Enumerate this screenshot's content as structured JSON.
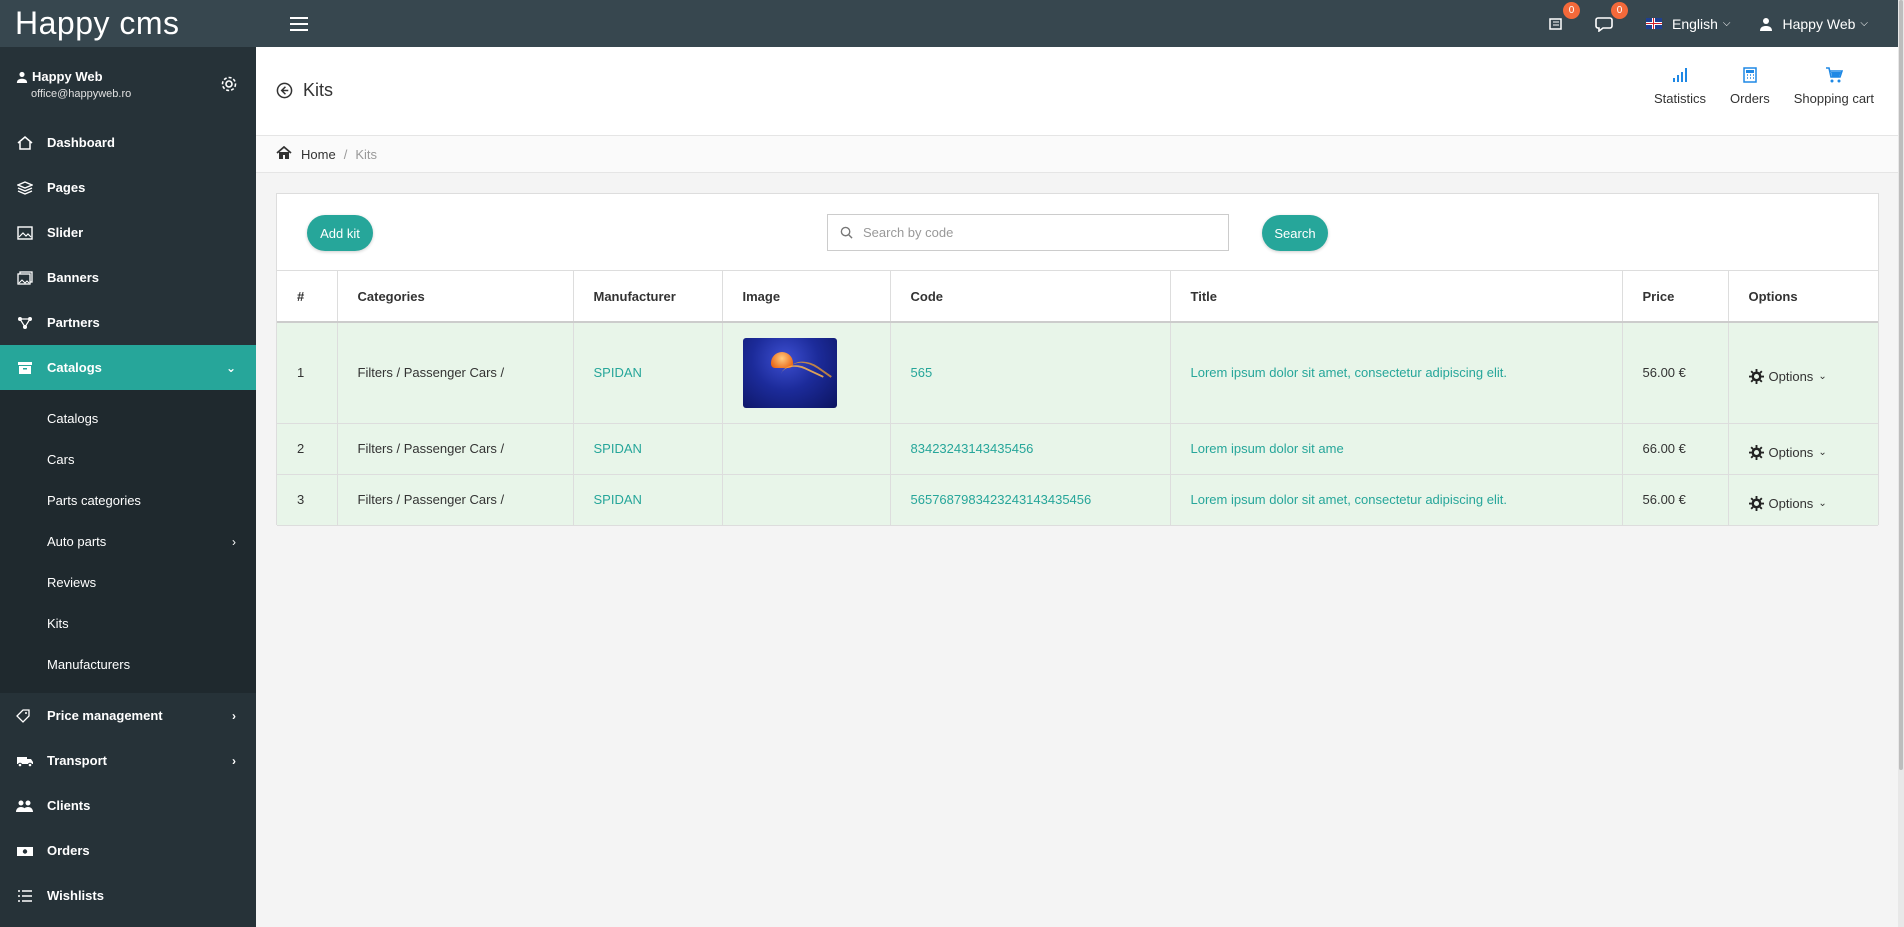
{
  "app": {
    "brand": "Happy cms"
  },
  "topbar": {
    "notifications_count": "0",
    "messages_count": "0",
    "language": "English",
    "user": "Happy Web"
  },
  "sidebar": {
    "profile": {
      "name": "Happy Web",
      "email": "office@happyweb.ro"
    },
    "items": [
      {
        "label": "Dashboard",
        "icon": "home-icon"
      },
      {
        "label": "Pages",
        "icon": "layers-icon"
      },
      {
        "label": "Slider",
        "icon": "image-icon"
      },
      {
        "label": "Banners",
        "icon": "images-icon"
      },
      {
        "label": "Partners",
        "icon": "network-icon"
      },
      {
        "label": "Catalogs",
        "icon": "archive-icon"
      }
    ],
    "submenu": [
      "Catalogs",
      "Cars",
      "Parts categories",
      "Auto parts",
      "Reviews",
      "Kits",
      "Manufacturers"
    ],
    "items_after": [
      {
        "label": "Price management",
        "icon": "price-tag-icon"
      },
      {
        "label": "Transport",
        "icon": "truck-icon"
      },
      {
        "label": "Clients",
        "icon": "users-icon"
      },
      {
        "label": "Orders",
        "icon": "cash-icon"
      },
      {
        "label": "Wishlists",
        "icon": "list-icon"
      }
    ]
  },
  "header": {
    "title": "Kits",
    "actions": [
      "Statistics",
      "Orders",
      "Shopping cart"
    ]
  },
  "breadcrumb": {
    "home": "Home",
    "current": "Kits"
  },
  "toolbar": {
    "add_label": "Add kit",
    "search_placeholder": "Search by code",
    "search_label": "Search"
  },
  "table": {
    "columns": [
      "#",
      "Categories",
      "Manufacturer",
      "Image",
      "Code",
      "Title",
      "Price",
      "Options"
    ],
    "rows": [
      {
        "num": "1",
        "category": "Filters / Passenger Cars /",
        "manufacturer": "SPIDAN",
        "has_image": true,
        "code": "565",
        "title": "Lorem ipsum dolor sit amet, consectetur adipiscing elit.",
        "price": "56.00 €",
        "options": "Options"
      },
      {
        "num": "2",
        "category": "Filters / Passenger Cars /",
        "manufacturer": "SPIDAN",
        "has_image": false,
        "code": "83423243143435456",
        "title": "Lorem ipsum dolor sit ame",
        "price": "66.00 €",
        "options": "Options"
      },
      {
        "num": "3",
        "category": "Filters / Passenger Cars /",
        "manufacturer": "SPIDAN",
        "has_image": false,
        "code": "5657687983423243143435456",
        "title": "Lorem ipsum dolor sit amet, consectetur adipiscing elit.",
        "price": "56.00 €",
        "options": "Options"
      }
    ]
  },
  "colors": {
    "accent": "#26a69a",
    "topbar": "#37474f",
    "sidebar": "#263238",
    "badge": "#f4693a",
    "row_bg": "#e8f5e9"
  }
}
